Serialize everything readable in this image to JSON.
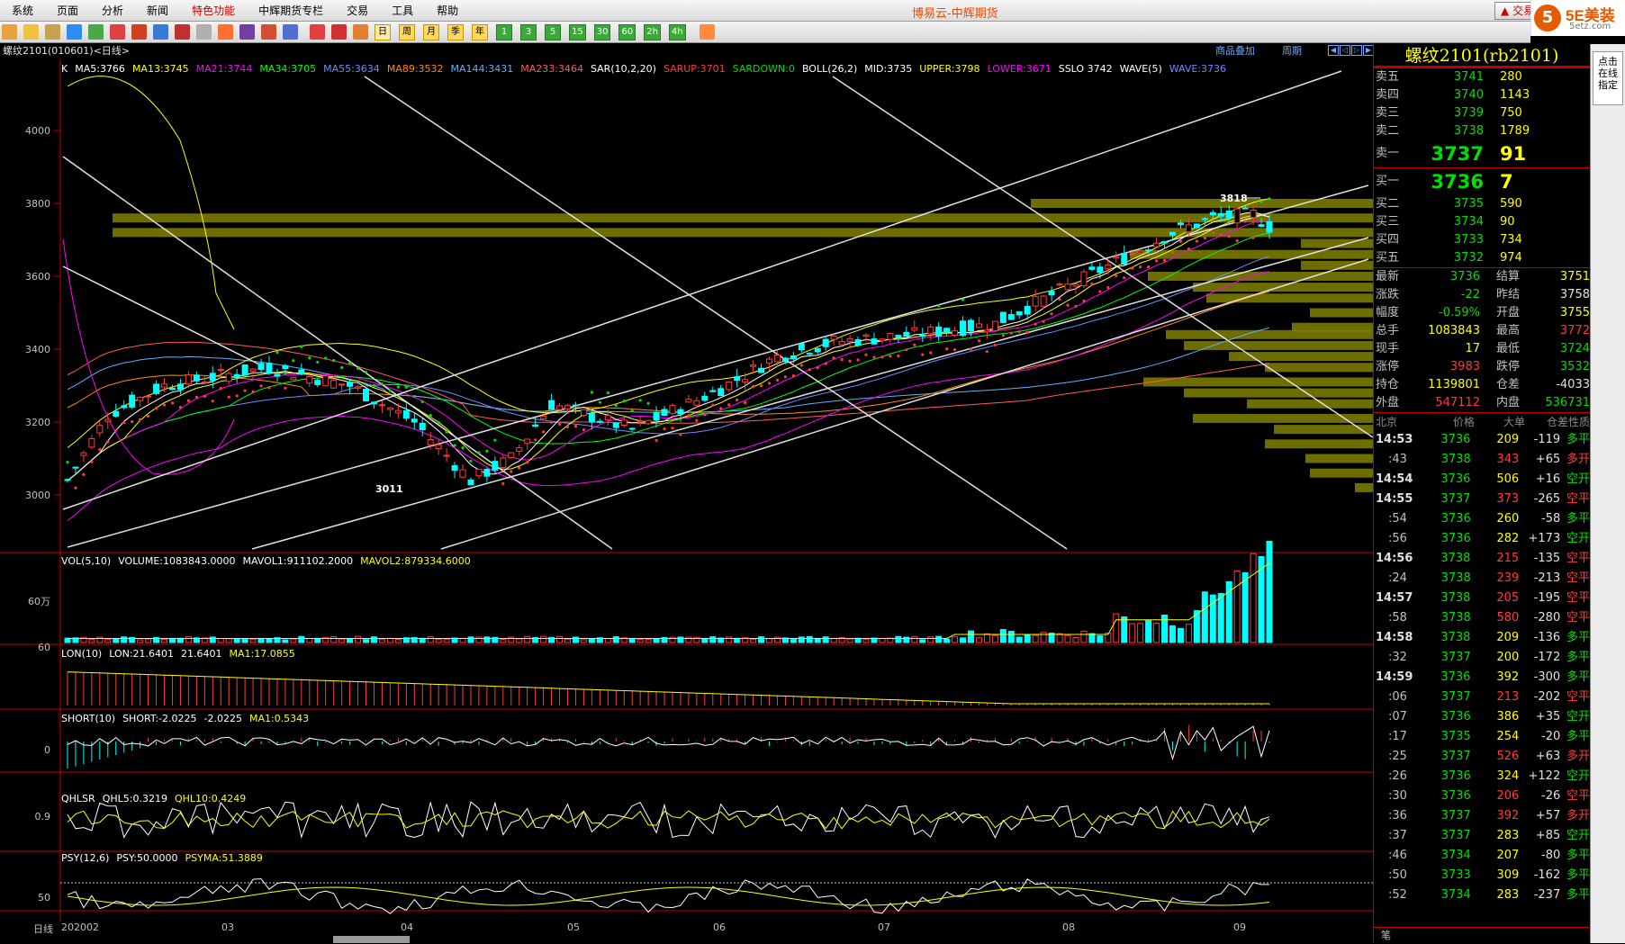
{
  "menu": [
    "系统",
    "页面",
    "分析",
    "新闻",
    "特色功能",
    "中辉期货专栏",
    "交易",
    "工具",
    "帮助"
  ],
  "menu_highlight_index": 4,
  "window_title": "博易云-中辉期货",
  "trade_button": "交易",
  "logo": {
    "mark": "5",
    "brand": "5E美装",
    "site": "5etz.com"
  },
  "toolbar_buttons": [
    "日",
    "周",
    "月",
    "季",
    "年",
    "1",
    "3",
    "5",
    "15",
    "30",
    "60",
    "2h",
    "4h"
  ],
  "chart_title": "螺纹2101(010601)<日线>",
  "sub_tabs": [
    "商品叠加",
    "周期"
  ],
  "main_indicator": {
    "label": "K",
    "items": [
      {
        "t": "MA5:3766",
        "c": "#ffffff"
      },
      {
        "t": "MA13:3745",
        "c": "#ffff00"
      },
      {
        "t": "MA21:3744",
        "c": "#ff00ff"
      },
      {
        "t": "MA34:3705",
        "c": "#00ff00"
      },
      {
        "t": "MA55:3634",
        "c": "#6a8cff"
      },
      {
        "t": "MA89:3532",
        "c": "#ff8c00"
      },
      {
        "t": "MA144:3431",
        "c": "#5fb0ff"
      },
      {
        "t": "MA233:3464",
        "c": "#ff5a5a"
      },
      {
        "t": "SAR(10,2,20)",
        "c": "#ffffff"
      },
      {
        "t": "SARUP:3701",
        "c": "#ff3b3b"
      },
      {
        "t": "SARDOWN:0",
        "c": "#00e000"
      },
      {
        "t": "BOLL(26,2)",
        "c": "#ffffff"
      },
      {
        "t": "MID:3735",
        "c": "#ffffff"
      },
      {
        "t": "UPPER:3798",
        "c": "#ffff00"
      },
      {
        "t": "LOWER:3671",
        "c": "#ff00ff"
      },
      {
        "t": "SSLO 3742",
        "c": "#ffffff"
      },
      {
        "t": "WAVE(5)",
        "c": "#ffffff"
      },
      {
        "t": "WAVE:3736",
        "c": "#6a8cff"
      }
    ]
  },
  "price_axis": [
    "4000",
    "3800",
    "3600",
    "3400",
    "3200",
    "3000"
  ],
  "annotations": {
    "high": "3818",
    "low": "3011"
  },
  "vol_indicator": [
    {
      "t": "VOL(5,10)",
      "c": "#ffffff"
    },
    {
      "t": "VOLUME:1083843.0000",
      "c": "#ffffff"
    },
    {
      "t": "MAVOL1:911102.2000",
      "c": "#ffffff"
    },
    {
      "t": "MAVOL2:879334.6000",
      "c": "#ffff00"
    }
  ],
  "vol_axis": "60万",
  "lon_indicator": [
    {
      "t": "LON(10)",
      "c": "#ffffff"
    },
    {
      "t": "LON:21.6401",
      "c": "#ffffff"
    },
    {
      "t": "21.6401",
      "c": "#ffffff"
    },
    {
      "t": "MA1:17.0855",
      "c": "#ffff00"
    }
  ],
  "lon_axis": "60",
  "short_indicator": [
    {
      "t": "SHORT(10)",
      "c": "#ffffff"
    },
    {
      "t": "SHORT:-2.0225",
      "c": "#ffffff"
    },
    {
      "t": "-2.0225",
      "c": "#ffffff"
    },
    {
      "t": "MA1:0.5343",
      "c": "#ffff00"
    }
  ],
  "short_axis": "0",
  "qhlsr_indicator": [
    {
      "t": "QHLSR",
      "c": "#ffffff"
    },
    {
      "t": "QHL5:0.3219",
      "c": "#ffffff"
    },
    {
      "t": "QHL10:0.4249",
      "c": "#ffff00"
    }
  ],
  "qhlsr_axis": "0.9",
  "psy_indicator": [
    {
      "t": "PSY(12,6)",
      "c": "#ffffff"
    },
    {
      "t": "PSY:50.0000",
      "c": "#ffffff"
    },
    {
      "t": "PSYMA:51.3889",
      "c": "#ffff00"
    }
  ],
  "psy_axis": "50",
  "x_axis": {
    "period_label": "日线",
    "labels": [
      "202002",
      "03",
      "04",
      "05",
      "06",
      "07",
      "08",
      "09"
    ]
  },
  "right_panel": {
    "title": "螺纹2101(rb2101)",
    "asks": [
      {
        "label": "卖五",
        "price": "3741",
        "vol": "280"
      },
      {
        "label": "卖四",
        "price": "3740",
        "vol": "1143"
      },
      {
        "label": "卖三",
        "price": "3739",
        "vol": "750"
      },
      {
        "label": "卖二",
        "price": "3738",
        "vol": "1789"
      },
      {
        "label": "卖一",
        "price": "3737",
        "vol": "91"
      }
    ],
    "bids": [
      {
        "label": "买一",
        "price": "3736",
        "vol": "7"
      },
      {
        "label": "买二",
        "price": "3735",
        "vol": "590"
      },
      {
        "label": "买三",
        "price": "3734",
        "vol": "90"
      },
      {
        "label": "买四",
        "price": "3733",
        "vol": "734"
      },
      {
        "label": "买五",
        "price": "3732",
        "vol": "974"
      }
    ],
    "quotes": [
      {
        "l1": "最新",
        "v1": "3736",
        "c1": "grn",
        "l2": "结算",
        "v2": "3751",
        "c2": "yel"
      },
      {
        "l1": "涨跌",
        "v1": "-22",
        "c1": "grn",
        "l2": "昨结",
        "v2": "3758",
        "c2": "wht"
      },
      {
        "l1": "幅度",
        "v1": "-0.59%",
        "c1": "grn",
        "l2": "开盘",
        "v2": "3755",
        "c2": "yel"
      },
      {
        "l1": "总手",
        "v1": "1083843",
        "c1": "yel",
        "l2": "最高",
        "v2": "3772",
        "c2": "red"
      },
      {
        "l1": "现手",
        "v1": "17",
        "c1": "yel",
        "l2": "最低",
        "v2": "3724",
        "c2": "grn"
      },
      {
        "l1": "涨停",
        "v1": "3983",
        "c1": "red",
        "l2": "跌停",
        "v2": "3532",
        "c2": "grn"
      },
      {
        "l1": "持仓",
        "v1": "1139801",
        "c1": "yel",
        "l2": "仓差",
        "v2": "-4033",
        "c2": "wht"
      },
      {
        "l1": "外盘",
        "v1": "547112",
        "c1": "red",
        "l2": "内盘",
        "v2": "536731",
        "c2": "grn"
      }
    ],
    "tick_header": [
      "北京",
      "价格",
      "大单",
      "仓差",
      "性质"
    ],
    "ticks": [
      {
        "t": "14:53",
        "p": "3736",
        "pc": "grn",
        "v": "209",
        "vc": "yel",
        "d": "-119",
        "k": "多平",
        "kc": "grn"
      },
      {
        "t": ":43",
        "p": "3738",
        "pc": "grn",
        "v": "343",
        "vc": "red",
        "d": "+65",
        "k": "多开",
        "kc": "red"
      },
      {
        "t": "14:54",
        "p": "3736",
        "pc": "grn",
        "v": "506",
        "vc": "yel",
        "d": "+16",
        "k": "空开",
        "kc": "grn"
      },
      {
        "t": "14:55",
        "p": "3737",
        "pc": "grn",
        "v": "373",
        "vc": "red",
        "d": "-265",
        "k": "空平",
        "kc": "red"
      },
      {
        "t": ":54",
        "p": "3736",
        "pc": "grn",
        "v": "260",
        "vc": "yel",
        "d": "-58",
        "k": "多平",
        "kc": "grn"
      },
      {
        "t": ":56",
        "p": "3736",
        "pc": "grn",
        "v": "282",
        "vc": "yel",
        "d": "+173",
        "k": "空开",
        "kc": "grn"
      },
      {
        "t": "14:56",
        "p": "3738",
        "pc": "grn",
        "v": "215",
        "vc": "red",
        "d": "-135",
        "k": "空平",
        "kc": "red"
      },
      {
        "t": ":24",
        "p": "3738",
        "pc": "grn",
        "v": "239",
        "vc": "red",
        "d": "-213",
        "k": "空平",
        "kc": "red"
      },
      {
        "t": "14:57",
        "p": "3738",
        "pc": "grn",
        "v": "205",
        "vc": "red",
        "d": "-195",
        "k": "空平",
        "kc": "red"
      },
      {
        "t": ":58",
        "p": "3738",
        "pc": "grn",
        "v": "580",
        "vc": "red",
        "d": "-280",
        "k": "空平",
        "kc": "red"
      },
      {
        "t": "14:58",
        "p": "3738",
        "pc": "grn",
        "v": "209",
        "vc": "yel",
        "d": "-136",
        "k": "多平",
        "kc": "grn"
      },
      {
        "t": ":32",
        "p": "3737",
        "pc": "grn",
        "v": "200",
        "vc": "yel",
        "d": "-172",
        "k": "多平",
        "kc": "grn"
      },
      {
        "t": "14:59",
        "p": "3736",
        "pc": "grn",
        "v": "392",
        "vc": "yel",
        "d": "-300",
        "k": "多平",
        "kc": "grn"
      },
      {
        "t": ":06",
        "p": "3737",
        "pc": "grn",
        "v": "213",
        "vc": "red",
        "d": "-202",
        "k": "空平",
        "kc": "red"
      },
      {
        "t": ":07",
        "p": "3736",
        "pc": "grn",
        "v": "386",
        "vc": "yel",
        "d": "+35",
        "k": "空开",
        "kc": "grn"
      },
      {
        "t": ":17",
        "p": "3735",
        "pc": "grn",
        "v": "254",
        "vc": "yel",
        "d": "-20",
        "k": "多平",
        "kc": "grn"
      },
      {
        "t": ":25",
        "p": "3737",
        "pc": "grn",
        "v": "526",
        "vc": "red",
        "d": "+63",
        "k": "多开",
        "kc": "red"
      },
      {
        "t": ":26",
        "p": "3736",
        "pc": "grn",
        "v": "324",
        "vc": "yel",
        "d": "+122",
        "k": "空开",
        "kc": "grn"
      },
      {
        "t": ":30",
        "p": "3736",
        "pc": "grn",
        "v": "206",
        "vc": "red",
        "d": "-26",
        "k": "空平",
        "kc": "red"
      },
      {
        "t": ":36",
        "p": "3737",
        "pc": "grn",
        "v": "392",
        "vc": "red",
        "d": "+57",
        "k": "多开",
        "kc": "red"
      },
      {
        "t": ":37",
        "p": "3737",
        "pc": "grn",
        "v": "283",
        "vc": "yel",
        "d": "+85",
        "k": "空开",
        "kc": "grn"
      },
      {
        "t": ":46",
        "p": "3734",
        "pc": "grn",
        "v": "207",
        "vc": "yel",
        "d": "-80",
        "k": "多平",
        "kc": "grn"
      },
      {
        "t": ":50",
        "p": "3733",
        "pc": "grn",
        "v": "309",
        "vc": "yel",
        "d": "-162",
        "k": "多平",
        "kc": "grn"
      },
      {
        "t": ":52",
        "p": "3734",
        "pc": "grn",
        "v": "283",
        "vc": "yel",
        "d": "-237",
        "k": "多平",
        "kc": "grn"
      }
    ],
    "footer": "笔"
  },
  "side_box": "点击在线指定",
  "colors": {
    "up": "#ff3b3b",
    "down": "#00ffff",
    "panel_border": "#c00000",
    "volume_profile": "#808000"
  }
}
